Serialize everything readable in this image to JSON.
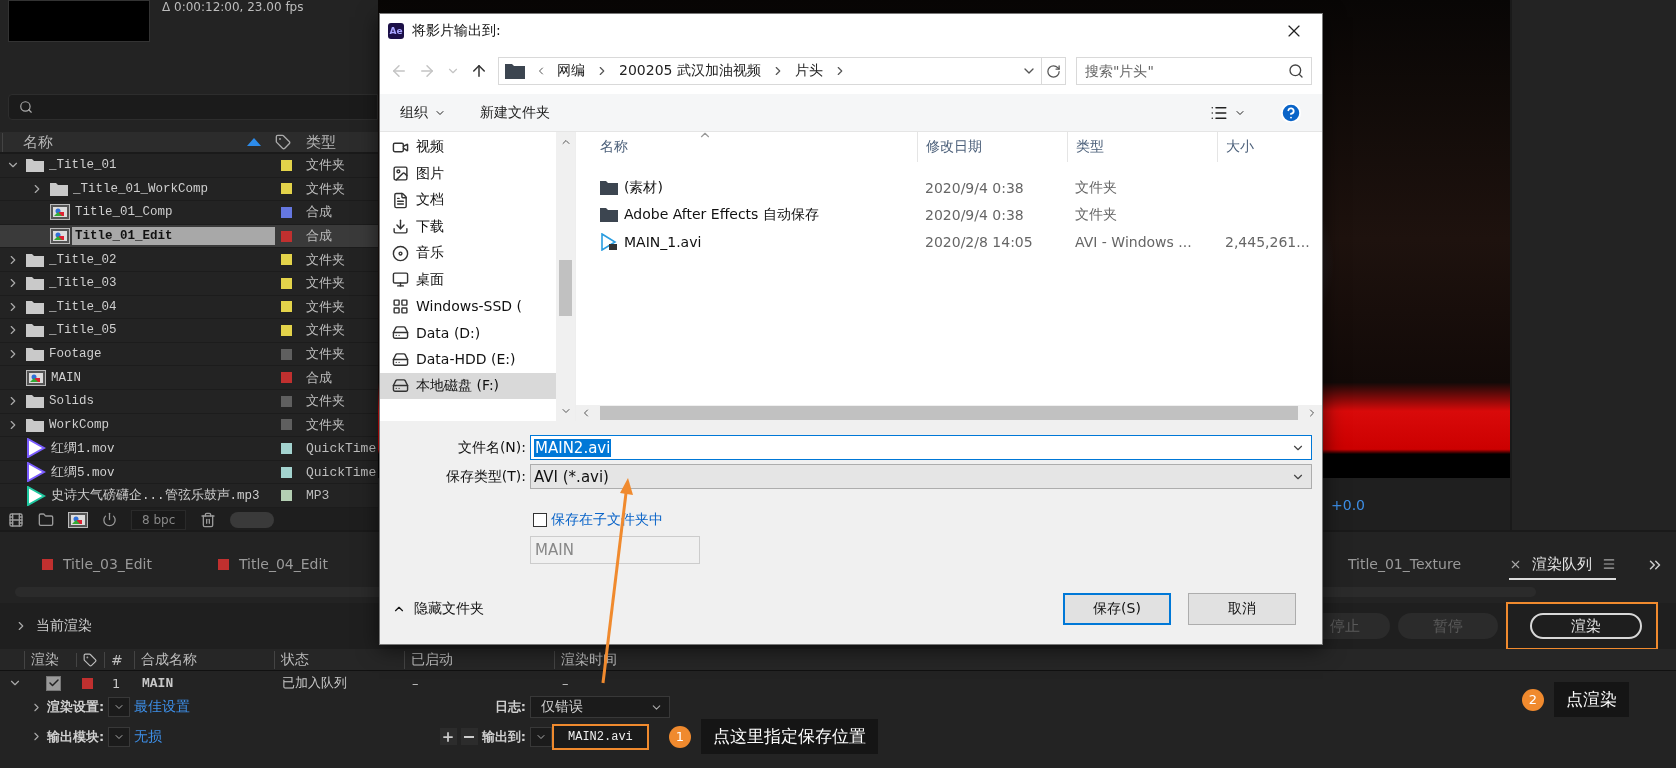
{
  "project_panel": {
    "info": "Δ 0:00:12:00, 23.00 fps",
    "columns": [
      "名称",
      "类型"
    ],
    "items": [
      {
        "kind": "folder",
        "name": "_Title_01",
        "color": "#e3d34a",
        "type": "文件夹",
        "expanded": true,
        "selected": false,
        "children": [
          {
            "kind": "folder",
            "name": "_Title_01_WorkComp",
            "color": "#e3d34a",
            "type": "文件夹",
            "expanded": false,
            "selected": false
          },
          {
            "kind": "comp",
            "name": "Title_01_Comp",
            "color": "#6577e0",
            "type": "合成",
            "selected": false
          },
          {
            "kind": "comp",
            "name": "Title_01_Edit",
            "color": "#c0302f",
            "type": "合成",
            "selected": true
          }
        ]
      },
      {
        "kind": "folder",
        "name": "_Title_02",
        "color": "#e3d34a",
        "type": "文件夹",
        "expanded": false,
        "selected": false
      },
      {
        "kind": "folder",
        "name": "_Title_03",
        "color": "#e3d34a",
        "type": "文件夹",
        "expanded": false,
        "selected": false
      },
      {
        "kind": "folder",
        "name": "_Title_04",
        "color": "#e3d34a",
        "type": "文件夹",
        "expanded": false,
        "selected": false
      },
      {
        "kind": "folder",
        "name": "_Title_05",
        "color": "#e3d34a",
        "type": "文件夹",
        "expanded": false,
        "selected": false
      },
      {
        "kind": "folder",
        "name": "Footage",
        "color": "#5f5f5f",
        "type": "文件夹",
        "expanded": false,
        "selected": false
      },
      {
        "kind": "comp",
        "name": "MAIN",
        "color": "#c0302f",
        "type": "合成",
        "selected": false
      },
      {
        "kind": "folder",
        "name": "Solids",
        "color": "#5f5f5f",
        "type": "文件夹",
        "expanded": false,
        "selected": false
      },
      {
        "kind": "folder",
        "name": "WorkComp",
        "color": "#5f5f5f",
        "type": "文件夹",
        "expanded": false,
        "selected": false
      },
      {
        "kind": "video",
        "name": "红绸1.mov",
        "color": "#a3d3cf",
        "type": "QuickTime",
        "selected": false
      },
      {
        "kind": "video",
        "name": "红绸5.mov",
        "color": "#a3d3cf",
        "type": "QuickTime",
        "selected": false
      },
      {
        "kind": "audio",
        "name": "史诗大气磅礴企...管弦乐鼓声.mp3",
        "color": "#b4cfb3",
        "type": "MP3",
        "selected": false
      }
    ],
    "bit_depth": "8 bpc"
  },
  "viewer": {
    "exposure": "+0.0"
  },
  "dialog": {
    "app_icon": "Ae",
    "title": "将影片输出到:",
    "path": [
      "网编",
      "200205 武汉加油视频",
      "片头"
    ],
    "search_placeholder": "搜索\"片头\"",
    "toolbar": {
      "organize": "组织",
      "new_folder": "新建文件夹"
    },
    "nav_items": [
      {
        "kind": "video",
        "label": "视频",
        "selected": false
      },
      {
        "kind": "image",
        "label": "图片",
        "selected": false
      },
      {
        "kind": "document",
        "label": "文档",
        "selected": false
      },
      {
        "kind": "download",
        "label": "下载",
        "selected": false
      },
      {
        "kind": "music",
        "label": "音乐",
        "selected": false
      },
      {
        "kind": "desktop",
        "label": "桌面",
        "selected": false
      },
      {
        "kind": "system",
        "label": "Windows-SSD (",
        "selected": false
      },
      {
        "kind": "drive",
        "label": "Data (D:)",
        "selected": false
      },
      {
        "kind": "drive",
        "label": "Data-HDD (E:)",
        "selected": false
      },
      {
        "kind": "drive",
        "label": "本地磁盘 (F:)",
        "selected": true
      }
    ],
    "columns": [
      "名称",
      "修改日期",
      "类型",
      "大小"
    ],
    "files": [
      {
        "kind": "folder",
        "name": "(素材)",
        "date": "2020/9/4 0:38",
        "type": "文件夹"
      },
      {
        "kind": "folder",
        "name": "Adobe After Effects 自动保存",
        "date": "2020/9/4 0:38",
        "type": "文件夹"
      },
      {
        "kind": "video",
        "name": "MAIN_1.avi",
        "date": "2020/2/8 14:05",
        "type": "AVI - Windows ...",
        "size": "2,445,261..."
      }
    ],
    "file_name": {
      "label": "文件名(N):",
      "value": "MAIN2.avi"
    },
    "file_type": {
      "label": "保存类型(T):",
      "value": "AVI (*.avi)"
    },
    "subfolder": {
      "label": "保存在子文件夹中",
      "checked": false
    },
    "subfolder_name": "MAIN",
    "hide_folders": "隐藏文件夹",
    "buttons": [
      {
        "label": "保存(S)",
        "default": true
      },
      {
        "label": "取消",
        "default": false
      }
    ]
  },
  "render_queue": {
    "tabs": [
      {
        "label": "Title_03_Edit",
        "color": "#c0302f",
        "selected": false
      },
      {
        "label": "Title_04_Edit",
        "color": "#c0302f",
        "selected": false
      },
      {
        "label": "Title_01_Texture",
        "selected": false
      },
      {
        "label": "渲染队列",
        "selected": true
      }
    ],
    "current_render": "当前渲染",
    "buttons": [
      {
        "label": "停止",
        "disabled": true,
        "highlighted": false
      },
      {
        "label": "暂停",
        "disabled": true,
        "highlighted": false
      },
      {
        "label": "渲染",
        "disabled": false,
        "highlighted": true
      }
    ],
    "columns": [
      "渲染",
      "#",
      "合成名称",
      "状态",
      "已启动",
      "渲染时间"
    ],
    "items": [
      {
        "checked": true,
        "expanded": true,
        "color": "#c0302f",
        "number": "1",
        "comp": "MAIN",
        "status": "已加入队列",
        "started": "–",
        "render_time": "–",
        "render_settings": {
          "label": "渲染设置:",
          "value": "最佳设置"
        },
        "log": {
          "label": "日志:",
          "value": "仅错误"
        },
        "output_module": {
          "label": "输出模块:",
          "value": "无损"
        },
        "output_to": {
          "label": "输出到:",
          "value": "MAIN2.avi",
          "highlighted": true
        }
      }
    ]
  },
  "callouts": [
    {
      "number": "1",
      "text": "点这里指定保存位置"
    },
    {
      "number": "2",
      "text": "点渲染"
    }
  ]
}
